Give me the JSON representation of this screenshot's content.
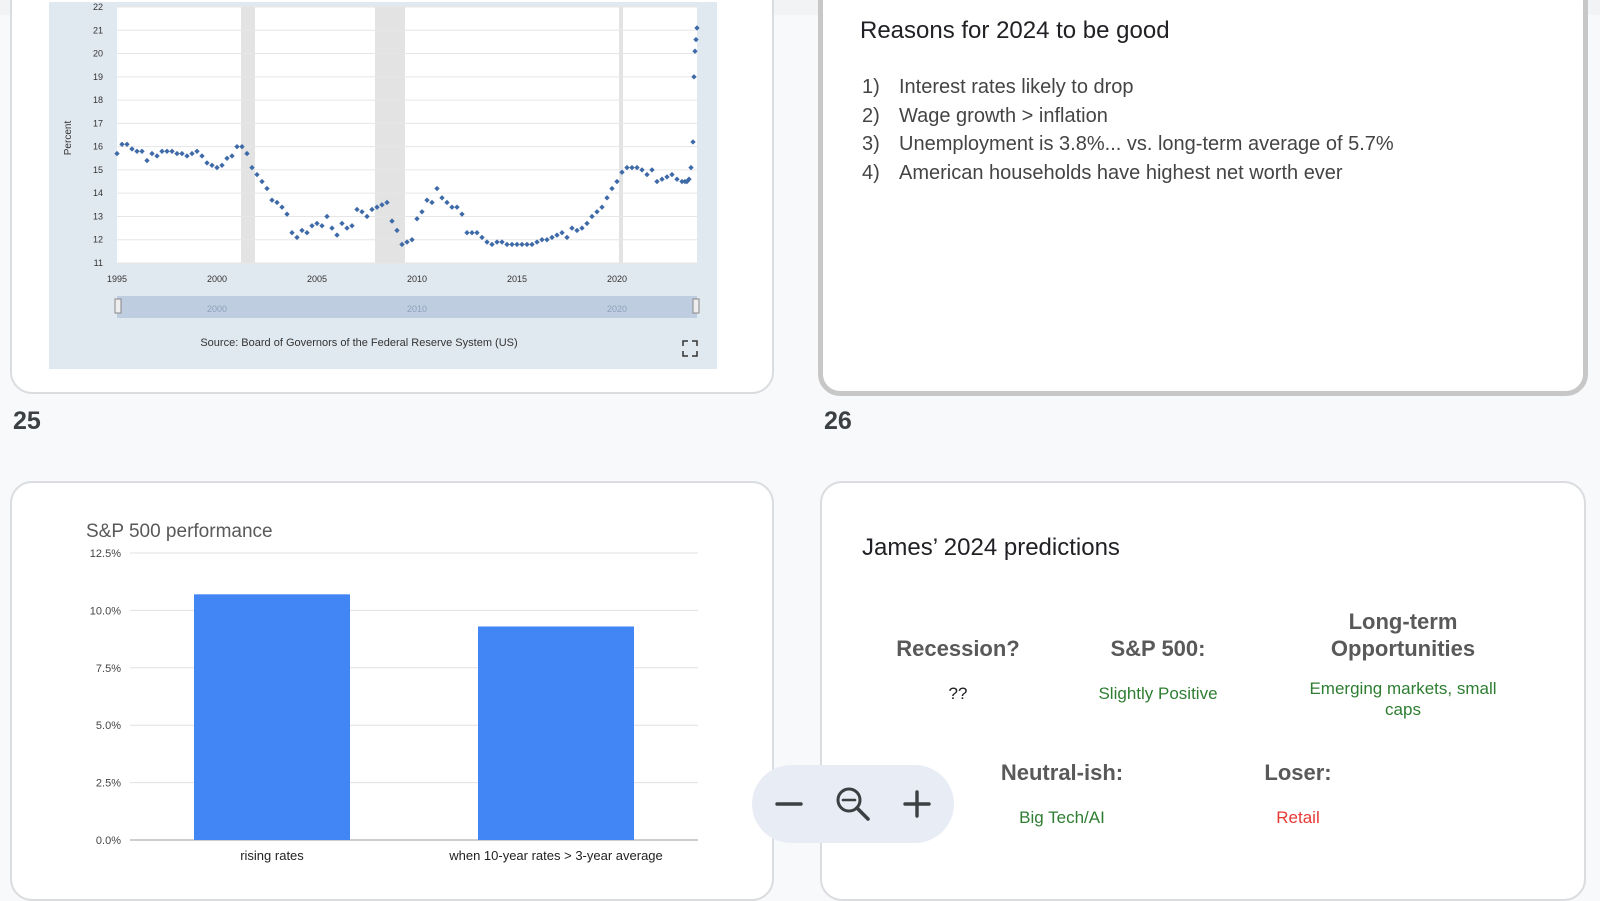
{
  "slide_25": {
    "number": "25",
    "chart_data": {
      "type": "scatter",
      "ylabel": "Percent",
      "ylim": [
        11,
        22
      ],
      "xlim": [
        1995,
        2023.9
      ],
      "y_ticks": [
        "11",
        "12",
        "13",
        "14",
        "15",
        "16",
        "17",
        "18",
        "19",
        "20",
        "21",
        "22"
      ],
      "x_ticks": [
        "1995",
        "2000",
        "2005",
        "2010",
        "2015",
        "2020"
      ],
      "navigator_ticks": [
        "2000",
        "2010",
        "2020"
      ],
      "source": "Source: Board of Governors of the Federal Reserve System (US)",
      "recessions": [
        [
          2001.2,
          2001.9
        ],
        [
          2007.9,
          2009.4
        ],
        [
          2020.1,
          2020.3
        ]
      ],
      "points": [
        [
          1995.0,
          15.7
        ],
        [
          1995.25,
          16.1
        ],
        [
          1995.5,
          16.1
        ],
        [
          1995.75,
          15.9
        ],
        [
          1996.0,
          15.8
        ],
        [
          1996.25,
          15.8
        ],
        [
          1996.5,
          15.4
        ],
        [
          1996.75,
          15.7
        ],
        [
          1997.0,
          15.6
        ],
        [
          1997.25,
          15.8
        ],
        [
          1997.5,
          15.8
        ],
        [
          1997.75,
          15.8
        ],
        [
          1998.0,
          15.7
        ],
        [
          1998.25,
          15.7
        ],
        [
          1998.5,
          15.6
        ],
        [
          1998.75,
          15.7
        ],
        [
          1999.0,
          15.8
        ],
        [
          1999.25,
          15.6
        ],
        [
          1999.5,
          15.3
        ],
        [
          1999.75,
          15.2
        ],
        [
          2000.0,
          15.1
        ],
        [
          2000.25,
          15.2
        ],
        [
          2000.5,
          15.5
        ],
        [
          2000.75,
          15.6
        ],
        [
          2001.0,
          16.0
        ],
        [
          2001.25,
          16.0
        ],
        [
          2001.5,
          15.7
        ],
        [
          2001.75,
          15.1
        ],
        [
          2002.0,
          14.8
        ],
        [
          2002.25,
          14.5
        ],
        [
          2002.5,
          14.2
        ],
        [
          2002.75,
          13.7
        ],
        [
          2003.0,
          13.6
        ],
        [
          2003.25,
          13.4
        ],
        [
          2003.5,
          13.1
        ],
        [
          2003.75,
          12.3
        ],
        [
          2004.0,
          12.1
        ],
        [
          2004.25,
          12.4
        ],
        [
          2004.5,
          12.3
        ],
        [
          2004.75,
          12.6
        ],
        [
          2005.0,
          12.7
        ],
        [
          2005.25,
          12.6
        ],
        [
          2005.5,
          13.0
        ],
        [
          2005.75,
          12.5
        ],
        [
          2006.0,
          12.2
        ],
        [
          2006.25,
          12.7
        ],
        [
          2006.5,
          12.5
        ],
        [
          2006.75,
          12.6
        ],
        [
          2007.0,
          13.3
        ],
        [
          2007.25,
          13.2
        ],
        [
          2007.5,
          13.0
        ],
        [
          2007.75,
          13.3
        ],
        [
          2008.0,
          13.4
        ],
        [
          2008.25,
          13.5
        ],
        [
          2008.5,
          13.6
        ],
        [
          2008.75,
          12.8
        ],
        [
          2009.0,
          12.4
        ],
        [
          2009.25,
          11.8
        ],
        [
          2009.5,
          11.9
        ],
        [
          2009.75,
          12.0
        ],
        [
          2010.0,
          12.9
        ],
        [
          2010.25,
          13.2
        ],
        [
          2010.5,
          13.7
        ],
        [
          2010.75,
          13.6
        ],
        [
          2011.0,
          14.2
        ],
        [
          2011.25,
          13.8
        ],
        [
          2011.5,
          13.6
        ],
        [
          2011.75,
          13.4
        ],
        [
          2012.0,
          13.4
        ],
        [
          2012.25,
          13.1
        ],
        [
          2012.5,
          12.3
        ],
        [
          2012.75,
          12.3
        ],
        [
          2013.0,
          12.3
        ],
        [
          2013.25,
          12.1
        ],
        [
          2013.5,
          11.9
        ],
        [
          2013.75,
          11.8
        ],
        [
          2014.0,
          11.9
        ],
        [
          2014.25,
          11.9
        ],
        [
          2014.5,
          11.8
        ],
        [
          2014.75,
          11.8
        ],
        [
          2015.0,
          11.8
        ],
        [
          2015.25,
          11.8
        ],
        [
          2015.5,
          11.8
        ],
        [
          2015.75,
          11.8
        ],
        [
          2016.0,
          11.9
        ],
        [
          2016.25,
          12.0
        ],
        [
          2016.5,
          12.0
        ],
        [
          2016.75,
          12.1
        ],
        [
          2017.0,
          12.2
        ],
        [
          2017.25,
          12.3
        ],
        [
          2017.5,
          12.1
        ],
        [
          2017.75,
          12.5
        ],
        [
          2018.0,
          12.4
        ],
        [
          2018.25,
          12.5
        ],
        [
          2018.5,
          12.7
        ],
        [
          2018.75,
          13.0
        ],
        [
          2019.0,
          13.2
        ],
        [
          2019.25,
          13.4
        ],
        [
          2019.5,
          13.8
        ],
        [
          2019.75,
          14.2
        ],
        [
          2020.0,
          14.5
        ],
        [
          2020.25,
          14.9
        ],
        [
          2020.5,
          15.1
        ],
        [
          2020.75,
          15.1
        ],
        [
          2021.0,
          15.1
        ],
        [
          2021.25,
          15.0
        ],
        [
          2021.5,
          14.8
        ],
        [
          2021.75,
          15.0
        ],
        [
          2022.0,
          14.5
        ],
        [
          2022.25,
          14.6
        ],
        [
          2022.5,
          14.7
        ],
        [
          2022.75,
          14.8
        ],
        [
          2023.0,
          14.6
        ],
        [
          2023.25,
          14.5
        ],
        [
          2023.4,
          14.5
        ],
        [
          2023.5,
          14.5
        ],
        [
          2023.6,
          14.6
        ],
        [
          2023.7,
          15.1
        ],
        [
          2023.8,
          16.2
        ],
        [
          2023.85,
          19.0
        ],
        [
          2023.9,
          20.1
        ],
        [
          2023.95,
          20.6
        ],
        [
          2024.0,
          21.1
        ]
      ]
    }
  },
  "slide_26": {
    "number": "26",
    "title": "Reasons for 2024 to be good",
    "reasons": [
      {
        "n": "1)",
        "text": "Interest rates likely to drop"
      },
      {
        "n": "2)",
        "text": "Wage growth > inflation"
      },
      {
        "n": "3)",
        "text": "Unemployment is 3.8%... vs. long-term average of 5.7%"
      },
      {
        "n": "4)",
        "text": "American households have highest net worth ever"
      }
    ]
  },
  "slide_27": {
    "chart_data": {
      "type": "bar",
      "title": "S&P 500 performance",
      "categories": [
        "rising rates",
        "when 10-year rates > 3-year average"
      ],
      "values": [
        10.7,
        9.3
      ],
      "ylim": [
        0,
        12.5
      ],
      "y_ticks": [
        "0.0%",
        "2.5%",
        "5.0%",
        "7.5%",
        "10.0%",
        "12.5%"
      ],
      "bar_color": "#4285f4"
    }
  },
  "slide_28": {
    "title": "James’ 2024 predictions",
    "recession_label": "Recession?",
    "recession_value": "??",
    "sp500_label": "S&P 500:",
    "sp500_value": "Slightly Positive",
    "longterm_label": "Long-term Opportunities",
    "longterm_value": "Emerging markets, small caps",
    "neutral_label": "Neutral-ish:",
    "neutral_value": "Big Tech/AI",
    "loser_label": "Loser:",
    "loser_value": "Retail"
  },
  "zoom_controls": {
    "zoom_out": "minus-icon",
    "zoom_reset": "zoom-out-magnifier-icon",
    "zoom_in": "plus-icon"
  }
}
